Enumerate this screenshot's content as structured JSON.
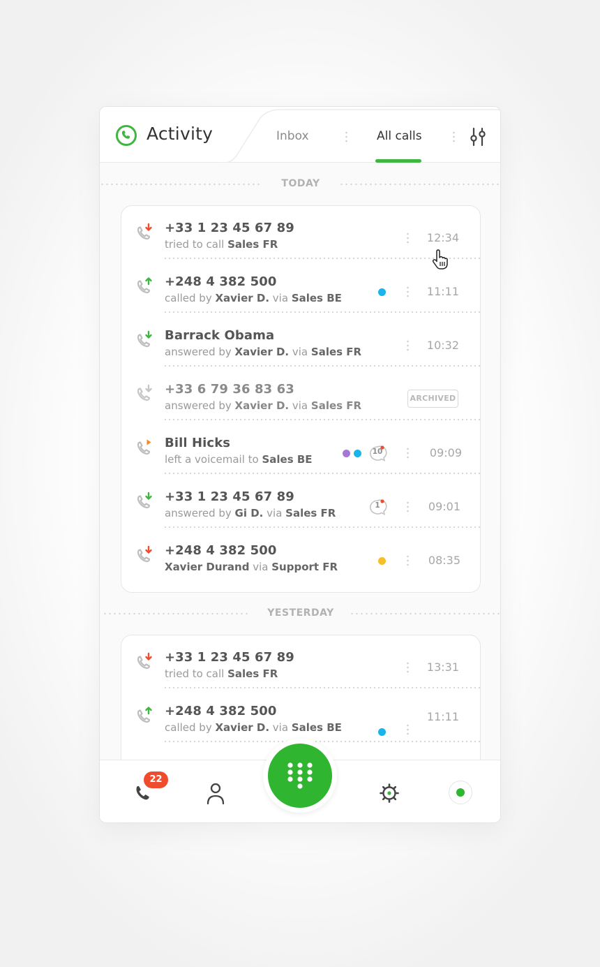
{
  "header": {
    "title": "Activity",
    "tabs": [
      {
        "label": "Inbox",
        "active": false
      },
      {
        "label": "All calls",
        "active": true
      }
    ]
  },
  "colors": {
    "accent": "#3fb63f",
    "missed": "#ef4b2d",
    "outgoing": "#3fb63f",
    "incoming": "#3fb63f",
    "voicemail": "#f58a1f",
    "dot_blue": "#1ab3ea",
    "dot_purple": "#a678d6",
    "dot_yellow": "#f7be25"
  },
  "sections": {
    "today": {
      "label": "TODAY",
      "rows": [
        {
          "type": "missed",
          "name": "+33 1 23 45 67 89",
          "sub_prefix": "tried to call ",
          "sub_bold": "Sales FR",
          "time": "12:34"
        },
        {
          "type": "outgoing",
          "name": "+248 4 382 500",
          "sub_prefix": "called by ",
          "sub_bold": "Xavier D.",
          "sub_mid": " via ",
          "sub_bold2": "Sales BE",
          "time": "11:11",
          "dots": [
            "blue"
          ]
        },
        {
          "type": "incoming",
          "name": "Barrack Obama",
          "sub_prefix": "answered by ",
          "sub_bold": "Xavier D.",
          "sub_mid": " via ",
          "sub_bold2": "Sales FR",
          "time": "10:32"
        },
        {
          "type": "archived",
          "name": "+33 6 79 36 83 63",
          "sub_prefix": "answered by ",
          "sub_bold": "Xavier D.",
          "sub_mid": " via ",
          "sub_bold2": "Sales FR",
          "badge": "ARCHIVED"
        },
        {
          "type": "voicemail",
          "name": "Bill Hicks",
          "sub_prefix": "left a voicemail to ",
          "sub_bold": "Sales BE",
          "time": "09:09",
          "dots": [
            "purple",
            "blue"
          ],
          "comments": "10"
        },
        {
          "type": "incoming",
          "name": "+33 1 23 45 67 89",
          "sub_prefix": "answered by ",
          "sub_bold": "Gi D.",
          "sub_mid": " via ",
          "sub_bold2": "Sales FR",
          "time": "09:01",
          "comments": "1"
        },
        {
          "type": "missed",
          "name": "+248 4 382 500",
          "sub_prefix": "",
          "sub_bold": "Xavier Durand",
          "sub_mid": " via ",
          "sub_bold2": "Support FR",
          "time": "08:35",
          "dots": [
            "yellow"
          ]
        }
      ]
    },
    "yesterday": {
      "label": "YESTERDAY",
      "rows": [
        {
          "type": "missed",
          "name": "+33 1 23 45 67 89",
          "sub_prefix": "tried to call ",
          "sub_bold": "Sales FR",
          "time": "13:31"
        },
        {
          "type": "outgoing",
          "name": "+248 4 382 500",
          "sub_prefix": "called by ",
          "sub_bold": "Xavier D.",
          "sub_mid": " via ",
          "sub_bold2": "Sales BE",
          "time": "11:11",
          "dots": [
            "blue"
          ]
        }
      ]
    }
  },
  "bottom_nav": {
    "calls_badge": "22",
    "items": [
      "phone-icon",
      "contacts-icon",
      "dialpad-icon",
      "settings-icon",
      "status-icon"
    ]
  }
}
